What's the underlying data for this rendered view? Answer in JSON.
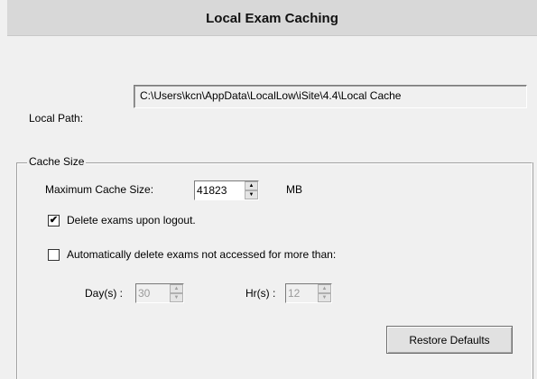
{
  "header": {
    "title": "Local Exam Caching"
  },
  "local_path": {
    "label": "Local Path:",
    "value": "C:\\Users\\kcn\\AppData\\LocalLow\\iSite\\4.4\\Local Cache"
  },
  "cache_size": {
    "group_title": "Cache Size",
    "max_label": "Maximum Cache Size:",
    "max_value": "41823",
    "unit": "MB",
    "delete_on_logout": {
      "label": "Delete exams upon logout.",
      "checked": true,
      "mark": "✔"
    },
    "auto_delete": {
      "label": "Automatically delete exams not accessed for more than:",
      "checked": false
    },
    "days": {
      "label": "Day(s) :",
      "value": "30"
    },
    "hours": {
      "label": "Hr(s) :",
      "value": "12"
    },
    "restore_button": "Restore Defaults"
  },
  "icons": {
    "spin_up": "▲",
    "spin_down": "▼"
  }
}
